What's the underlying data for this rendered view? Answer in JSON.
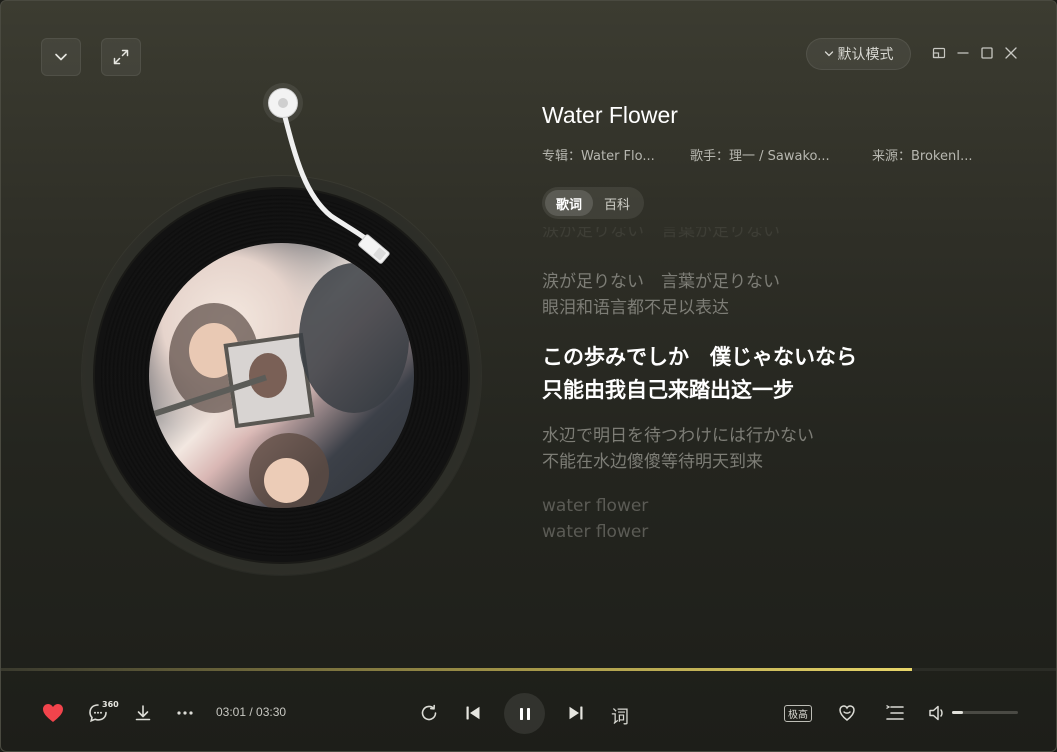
{
  "window": {
    "mode_label": "默认模式"
  },
  "song": {
    "title": "Water Flower",
    "album": "专辑：Water Flo...",
    "artist": "歌手：理一 / Sawako...",
    "source": "来源：BrokenI..."
  },
  "tabs": [
    {
      "label": "歌词",
      "active": true
    },
    {
      "label": "百科",
      "active": false
    }
  ],
  "lyrics": {
    "faded_top": "涙が足りない　言葉が足りない",
    "blocks": [
      {
        "original": "涙が足りない　言葉が足りない",
        "translation": "眼泪和语言都不足以表达",
        "state": "past"
      },
      {
        "original": "この歩みでしか　僕じゃないなら",
        "translation": "只能由我自己来踏出这一步",
        "state": "current"
      },
      {
        "original": "水辺で明日を待つわけには行かない",
        "translation": "不能在水边傻傻等待明天到来",
        "state": "next"
      },
      {
        "original": "water flower",
        "translation": "water flower",
        "state": "far"
      }
    ]
  },
  "player": {
    "time": "03:01 / 03:30",
    "progress_percent": 86.2,
    "comment_count": "360",
    "quality_label": "极高",
    "lyric_toggle_label": "词",
    "volume_percent": 16,
    "liked": true
  },
  "colors": {
    "like_red": "#f2444c",
    "progress_gold": "#e8d66a",
    "bg_top": "#3c3c31",
    "bg_bottom": "#1d1e19"
  },
  "icons": {
    "collapse": "chevron-down-icon",
    "fullscreen": "expand-icon",
    "mode": "chevron-down-icon",
    "mini": "mini-window-icon",
    "minimize": "minimize-icon",
    "maximize": "maximize-icon",
    "close": "close-icon",
    "like": "heart-icon",
    "comment": "comment-icon",
    "download": "download-icon",
    "more": "more-icon",
    "loop": "loop-icon",
    "prev": "previous-icon",
    "pause": "pause-icon",
    "next": "next-icon",
    "effect": "sound-effect-icon",
    "playlist": "playlist-icon",
    "volume": "volume-icon"
  }
}
